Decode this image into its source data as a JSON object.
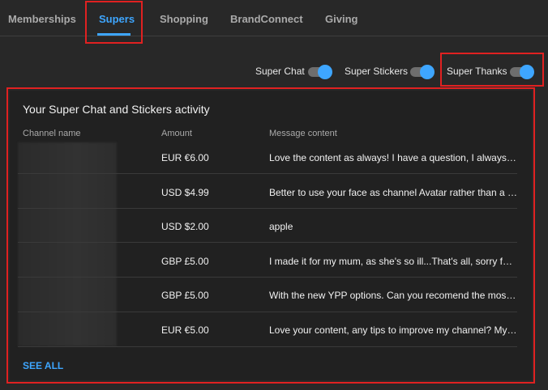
{
  "tabs": [
    "Memberships",
    "Supers",
    "Shopping",
    "BrandConnect",
    "Giving"
  ],
  "toggles": [
    {
      "label": "Super Chat",
      "on": true
    },
    {
      "label": "Super Stickers",
      "on": true
    },
    {
      "label": "Super Thanks",
      "on": true
    }
  ],
  "activity": {
    "title": "Your Super Chat and Stickers activity",
    "columns": [
      "Channel name",
      "Amount",
      "Message content"
    ],
    "rows": [
      {
        "amount": "EUR €6.00",
        "message": "Love the content as always! I have a question, I always ask myself"
      },
      {
        "amount": "USD $4.99",
        "message": "Better to use your face as channel Avatar rather than a logo?"
      },
      {
        "amount": "USD $2.00",
        "message": "apple"
      },
      {
        "amount": "GBP £5.00",
        "message": "I made it for my mum, as she's so ill...That's all, sorry for posting"
      },
      {
        "amount": "GBP £5.00",
        "message": "With the new YPP options. Can you recomend the most efficient way"
      },
      {
        "amount": "EUR €5.00",
        "message": "Love your content, any tips to improve my channel? My mentor said"
      }
    ],
    "see_all": "SEE ALL"
  },
  "colors": {
    "accent": "#3ea6ff",
    "highlight": "#e02121",
    "background": "#282828"
  }
}
